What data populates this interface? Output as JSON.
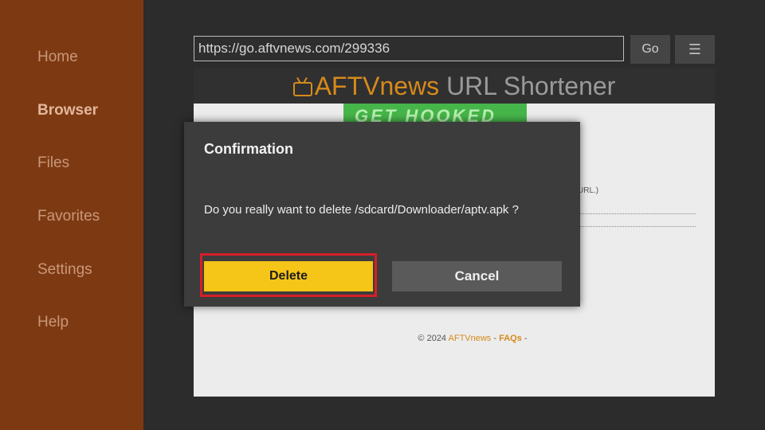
{
  "sidebar": {
    "items": [
      {
        "label": "Home"
      },
      {
        "label": "Browser",
        "active": true
      },
      {
        "label": "Files"
      },
      {
        "label": "Favorites"
      },
      {
        "label": "Settings"
      },
      {
        "label": "Help"
      }
    ]
  },
  "browser": {
    "url": "https://go.aftvnews.com/299336",
    "go_label": "Go",
    "menu_icon": "menu-icon"
  },
  "webpage": {
    "logo_text": "AFTVnews",
    "title_text": " URL Shortener",
    "icon": "tv-icon",
    "banner_text": "GET HOOKED",
    "hint_text": "URL.)",
    "footer_copyright": "© 2024 ",
    "footer_link": "AFTVnews",
    "footer_sep": " - ",
    "footer_faq": "FAQs",
    "footer_end": " -"
  },
  "dialog": {
    "title": "Confirmation",
    "message": "Do you really want to delete /sdcard/Downloader/aptv.apk ?",
    "delete_label": "Delete",
    "cancel_label": "Cancel"
  },
  "colors": {
    "sidebar_bg": "#7d3a12",
    "accent": "#f5c518",
    "highlight_border": "#d61f26",
    "logo_orange": "#d68a1b"
  }
}
